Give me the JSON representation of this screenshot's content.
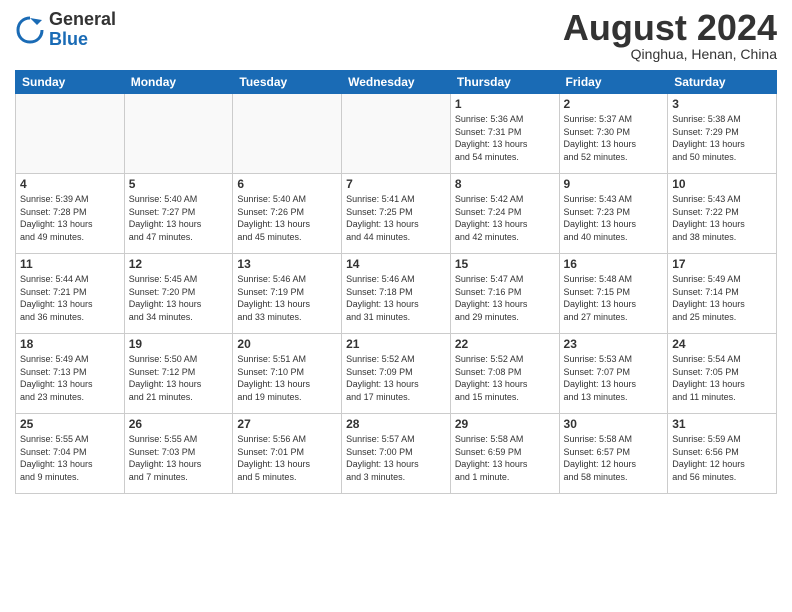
{
  "header": {
    "logo_general": "General",
    "logo_blue": "Blue",
    "month_title": "August 2024",
    "subtitle": "Qinghua, Henan, China"
  },
  "calendar": {
    "days_of_week": [
      "Sunday",
      "Monday",
      "Tuesday",
      "Wednesday",
      "Thursday",
      "Friday",
      "Saturday"
    ],
    "weeks": [
      [
        {
          "day": "",
          "info": ""
        },
        {
          "day": "",
          "info": ""
        },
        {
          "day": "",
          "info": ""
        },
        {
          "day": "",
          "info": ""
        },
        {
          "day": "1",
          "info": "Sunrise: 5:36 AM\nSunset: 7:31 PM\nDaylight: 13 hours\nand 54 minutes."
        },
        {
          "day": "2",
          "info": "Sunrise: 5:37 AM\nSunset: 7:30 PM\nDaylight: 13 hours\nand 52 minutes."
        },
        {
          "day": "3",
          "info": "Sunrise: 5:38 AM\nSunset: 7:29 PM\nDaylight: 13 hours\nand 50 minutes."
        }
      ],
      [
        {
          "day": "4",
          "info": "Sunrise: 5:39 AM\nSunset: 7:28 PM\nDaylight: 13 hours\nand 49 minutes."
        },
        {
          "day": "5",
          "info": "Sunrise: 5:40 AM\nSunset: 7:27 PM\nDaylight: 13 hours\nand 47 minutes."
        },
        {
          "day": "6",
          "info": "Sunrise: 5:40 AM\nSunset: 7:26 PM\nDaylight: 13 hours\nand 45 minutes."
        },
        {
          "day": "7",
          "info": "Sunrise: 5:41 AM\nSunset: 7:25 PM\nDaylight: 13 hours\nand 44 minutes."
        },
        {
          "day": "8",
          "info": "Sunrise: 5:42 AM\nSunset: 7:24 PM\nDaylight: 13 hours\nand 42 minutes."
        },
        {
          "day": "9",
          "info": "Sunrise: 5:43 AM\nSunset: 7:23 PM\nDaylight: 13 hours\nand 40 minutes."
        },
        {
          "day": "10",
          "info": "Sunrise: 5:43 AM\nSunset: 7:22 PM\nDaylight: 13 hours\nand 38 minutes."
        }
      ],
      [
        {
          "day": "11",
          "info": "Sunrise: 5:44 AM\nSunset: 7:21 PM\nDaylight: 13 hours\nand 36 minutes."
        },
        {
          "day": "12",
          "info": "Sunrise: 5:45 AM\nSunset: 7:20 PM\nDaylight: 13 hours\nand 34 minutes."
        },
        {
          "day": "13",
          "info": "Sunrise: 5:46 AM\nSunset: 7:19 PM\nDaylight: 13 hours\nand 33 minutes."
        },
        {
          "day": "14",
          "info": "Sunrise: 5:46 AM\nSunset: 7:18 PM\nDaylight: 13 hours\nand 31 minutes."
        },
        {
          "day": "15",
          "info": "Sunrise: 5:47 AM\nSunset: 7:16 PM\nDaylight: 13 hours\nand 29 minutes."
        },
        {
          "day": "16",
          "info": "Sunrise: 5:48 AM\nSunset: 7:15 PM\nDaylight: 13 hours\nand 27 minutes."
        },
        {
          "day": "17",
          "info": "Sunrise: 5:49 AM\nSunset: 7:14 PM\nDaylight: 13 hours\nand 25 minutes."
        }
      ],
      [
        {
          "day": "18",
          "info": "Sunrise: 5:49 AM\nSunset: 7:13 PM\nDaylight: 13 hours\nand 23 minutes."
        },
        {
          "day": "19",
          "info": "Sunrise: 5:50 AM\nSunset: 7:12 PM\nDaylight: 13 hours\nand 21 minutes."
        },
        {
          "day": "20",
          "info": "Sunrise: 5:51 AM\nSunset: 7:10 PM\nDaylight: 13 hours\nand 19 minutes."
        },
        {
          "day": "21",
          "info": "Sunrise: 5:52 AM\nSunset: 7:09 PM\nDaylight: 13 hours\nand 17 minutes."
        },
        {
          "day": "22",
          "info": "Sunrise: 5:52 AM\nSunset: 7:08 PM\nDaylight: 13 hours\nand 15 minutes."
        },
        {
          "day": "23",
          "info": "Sunrise: 5:53 AM\nSunset: 7:07 PM\nDaylight: 13 hours\nand 13 minutes."
        },
        {
          "day": "24",
          "info": "Sunrise: 5:54 AM\nSunset: 7:05 PM\nDaylight: 13 hours\nand 11 minutes."
        }
      ],
      [
        {
          "day": "25",
          "info": "Sunrise: 5:55 AM\nSunset: 7:04 PM\nDaylight: 13 hours\nand 9 minutes."
        },
        {
          "day": "26",
          "info": "Sunrise: 5:55 AM\nSunset: 7:03 PM\nDaylight: 13 hours\nand 7 minutes."
        },
        {
          "day": "27",
          "info": "Sunrise: 5:56 AM\nSunset: 7:01 PM\nDaylight: 13 hours\nand 5 minutes."
        },
        {
          "day": "28",
          "info": "Sunrise: 5:57 AM\nSunset: 7:00 PM\nDaylight: 13 hours\nand 3 minutes."
        },
        {
          "day": "29",
          "info": "Sunrise: 5:58 AM\nSunset: 6:59 PM\nDaylight: 13 hours\nand 1 minute."
        },
        {
          "day": "30",
          "info": "Sunrise: 5:58 AM\nSunset: 6:57 PM\nDaylight: 12 hours\nand 58 minutes."
        },
        {
          "day": "31",
          "info": "Sunrise: 5:59 AM\nSunset: 6:56 PM\nDaylight: 12 hours\nand 56 minutes."
        }
      ]
    ]
  }
}
